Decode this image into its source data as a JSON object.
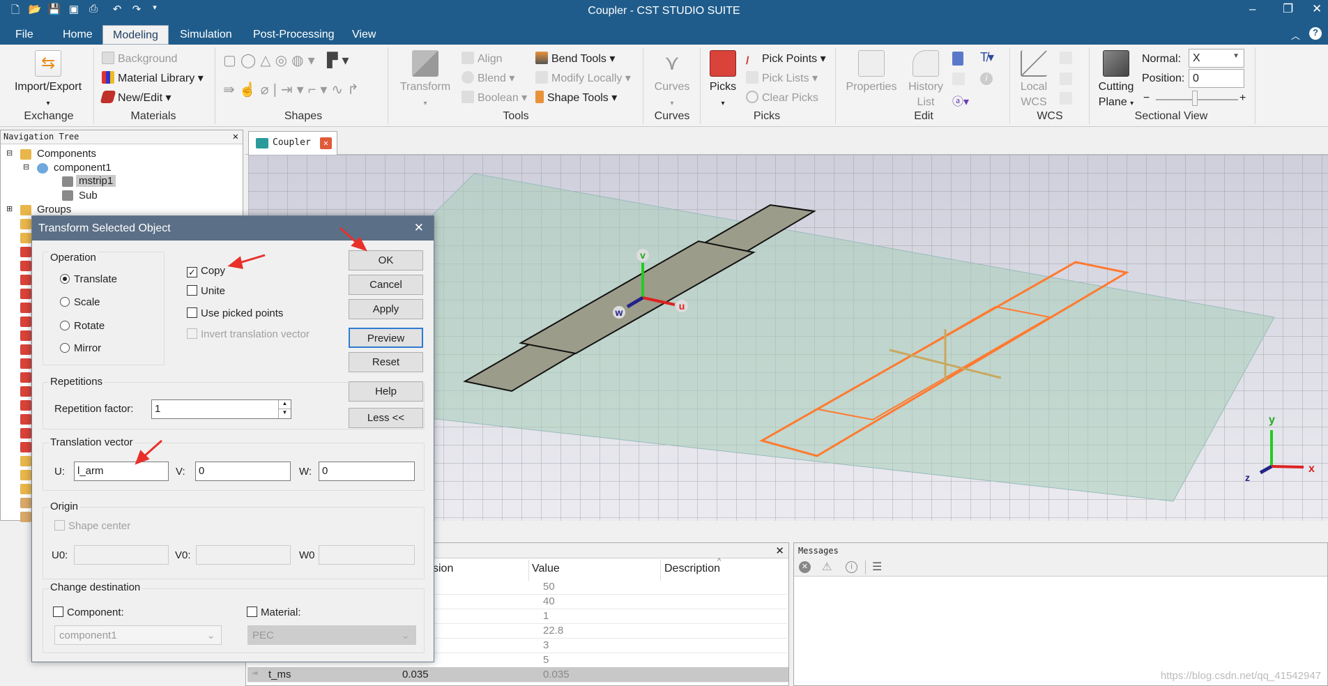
{
  "window": {
    "title": "Coupler - CST STUDIO SUITE"
  },
  "menu_tabs": [
    {
      "label": "File"
    },
    {
      "label": "Home"
    },
    {
      "label": "Modeling",
      "active": true
    },
    {
      "label": "Simulation"
    },
    {
      "label": "Post-Processing"
    },
    {
      "label": "View"
    }
  ],
  "ribbon": {
    "exchange": {
      "import_export": "Import/Export",
      "label": "Exchange"
    },
    "materials": {
      "background": "Background",
      "material_library": "Material Library",
      "new_edit": "New/Edit",
      "label": "Materials"
    },
    "shapes": {
      "label": "Shapes"
    },
    "tools": {
      "transform": "Transform",
      "align": "Align",
      "blend": "Blend",
      "boolean": "Boolean",
      "bend_tools": "Bend Tools",
      "modify_locally": "Modify Locally",
      "shape_tools": "Shape Tools",
      "label": "Tools"
    },
    "curves": {
      "curves": "Curves",
      "label": "Curves"
    },
    "picks": {
      "picks": "Picks",
      "pick_points": "Pick Points",
      "pick_lists": "Pick Lists",
      "clear_picks": "Clear Picks",
      "label": "Picks"
    },
    "edit": {
      "properties": "Properties",
      "history_list_1": "History",
      "history_list_2": "List",
      "label": "Edit"
    },
    "wcs": {
      "local_wcs_1": "Local",
      "local_wcs_2": "WCS",
      "label": "WCS"
    },
    "sectional": {
      "cutting_plane_1": "Cutting",
      "cutting_plane_2": "Plane",
      "normal_label": "Normal:",
      "normal_value": "X",
      "position_label": "Position:",
      "position_value": "0",
      "minus": "−",
      "plus": "+",
      "label": "Sectional View"
    }
  },
  "nav_tree": {
    "title": "Navigation Tree",
    "items": [
      {
        "label": "Components"
      },
      {
        "label": "component1"
      },
      {
        "label": "mstrip1",
        "selected": true
      },
      {
        "label": "Sub"
      },
      {
        "label": "Groups"
      }
    ]
  },
  "viewport": {
    "tab_label": "Coupler",
    "axes": {
      "u": "u",
      "v": "v",
      "w": "w",
      "x": "x",
      "y": "y",
      "z": "z"
    }
  },
  "dialog": {
    "title": "Transform Selected Object",
    "operation": {
      "label": "Operation",
      "options": [
        {
          "label": "Translate",
          "selected": true
        },
        {
          "label": "Scale"
        },
        {
          "label": "Rotate"
        },
        {
          "label": "Mirror"
        }
      ]
    },
    "options": {
      "copy": {
        "label": "Copy",
        "checked": true
      },
      "unite": {
        "label": "Unite",
        "checked": false
      },
      "use_picked": {
        "label": "Use picked points",
        "checked": false
      },
      "invert": {
        "label": "Invert translation vector",
        "checked": false,
        "disabled": true
      }
    },
    "buttons": {
      "ok": "OK",
      "cancel": "Cancel",
      "apply": "Apply",
      "preview": "Preview",
      "reset": "Reset",
      "help": "Help",
      "less": "Less <<"
    },
    "repetitions": {
      "label": "Repetitions",
      "factor_label": "Repetition factor:",
      "factor_value": "1"
    },
    "translation": {
      "label": "Translation vector",
      "u_label": "U:",
      "u_value": "l_arm",
      "v_label": "V:",
      "v_value": "0",
      "w_label": "W:",
      "w_value": "0"
    },
    "origin": {
      "label": "Origin",
      "shape_center": "Shape center",
      "u0_label": "U0:",
      "v0_label": "V0:",
      "w0_label": "W0"
    },
    "destination": {
      "label": "Change destination",
      "component_label": "Component:",
      "component_value": "component1",
      "material_label": "Material:",
      "material_value": "PEC"
    }
  },
  "parameters": {
    "columns": {
      "expression": "sion",
      "value": "Value",
      "description": "Description"
    },
    "values": [
      "50",
      "40",
      "1",
      "22.8",
      "3",
      "5"
    ],
    "last_row": {
      "name": "t_ms",
      "expression": "0.035",
      "value": "0.035"
    }
  },
  "messages": {
    "title": "Messages"
  },
  "watermark": "https://blog.csdn.net/qq_41542947",
  "colors": {
    "title_bar": "#1f5c8b",
    "dialog_title": "#5b6f86",
    "selection_orange": "#ff7a30",
    "annotation_red": "#e8302a"
  }
}
